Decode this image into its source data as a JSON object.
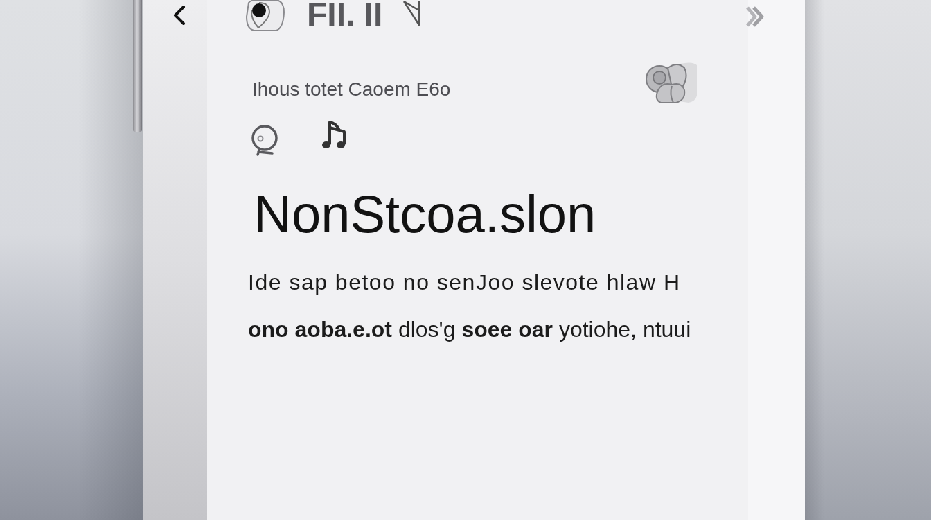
{
  "top_bar": {
    "title": "FII. II"
  },
  "header": {
    "subtitle": "Ihous totet Caoem E6o"
  },
  "headline": "NonStcoa.slon",
  "body_lines": [
    "Ide sap betoo no senJoo slevote hlaw H",
    "**ono aoba.e.ot** dlos'g **soee oar** yotiohe, ntuui"
  ]
}
